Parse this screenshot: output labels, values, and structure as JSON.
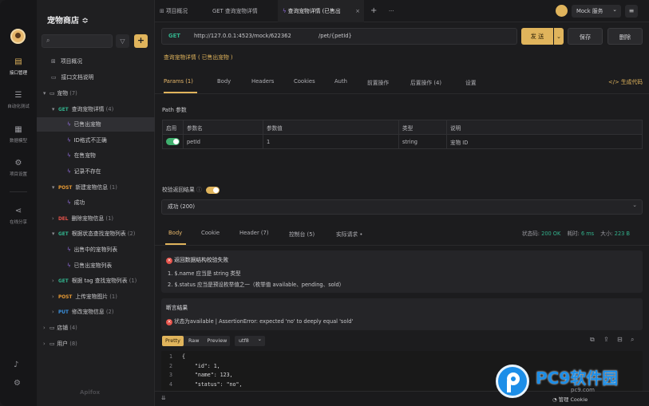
{
  "window": {
    "traffic_lights": [
      "#ff5f57",
      "#febc2e",
      "#28c840"
    ]
  },
  "rail": {
    "items": [
      {
        "label": "接口管理",
        "icon": "api-icon"
      },
      {
        "label": "自动化测试",
        "icon": "test-icon"
      },
      {
        "label": "数据模型",
        "icon": "model-icon"
      },
      {
        "label": "项目设置",
        "icon": "settings-icon"
      },
      {
        "label": "在线分享",
        "icon": "share-icon"
      }
    ]
  },
  "sidebar": {
    "project_name": "宠物商店 ≎",
    "search_placeholder": "",
    "add_label": "+",
    "top_items": [
      {
        "label": "项目概况"
      },
      {
        "label": "接口文档说明"
      }
    ],
    "tree": [
      {
        "indent": 0,
        "arrow": "▾",
        "folder": true,
        "label": "宠物",
        "count": "(7)"
      },
      {
        "indent": 1,
        "arrow": "▾",
        "method": "GET",
        "mclass": "m-get",
        "label": "查询宠物详情",
        "count": "(4)"
      },
      {
        "indent": 2,
        "case": true,
        "label": "已售出宠物",
        "selected": true
      },
      {
        "indent": 2,
        "case": true,
        "label": "ID格式不正确"
      },
      {
        "indent": 2,
        "case": true,
        "label": "在售宠物"
      },
      {
        "indent": 2,
        "case": true,
        "label": "记录不存在"
      },
      {
        "indent": 1,
        "arrow": "▾",
        "method": "POST",
        "mclass": "m-post",
        "label": "新建宠物信息",
        "count": "(1)"
      },
      {
        "indent": 2,
        "case": true,
        "label": "成功"
      },
      {
        "indent": 1,
        "arrow": "›",
        "method": "DEL",
        "mclass": "m-del",
        "label": "删除宠物信息",
        "count": "(1)"
      },
      {
        "indent": 1,
        "arrow": "▾",
        "method": "GET",
        "mclass": "m-get",
        "label": "根据状态查找宠物列表",
        "count": "(2)"
      },
      {
        "indent": 2,
        "case": true,
        "label": "出售中的宠物列表"
      },
      {
        "indent": 2,
        "case": true,
        "label": "已售出宠物列表"
      },
      {
        "indent": 1,
        "arrow": "›",
        "method": "GET",
        "mclass": "m-get",
        "label": "根据 tag 查找宠物列表",
        "count": "(1)"
      },
      {
        "indent": 1,
        "arrow": "›",
        "method": "POST",
        "mclass": "m-post",
        "label": "上传宠物图片",
        "count": "(1)"
      },
      {
        "indent": 1,
        "arrow": "›",
        "method": "PUT",
        "mclass": "m-put",
        "label": "修改宠物信息",
        "count": "(2)"
      },
      {
        "indent": 0,
        "arrow": "›",
        "folder": true,
        "label": "店铺",
        "count": "(4)"
      },
      {
        "indent": 0,
        "arrow": "›",
        "folder": true,
        "label": "用户",
        "count": "(8)"
      }
    ],
    "footer_logo": "Apifox"
  },
  "tabs": [
    {
      "label": "项目概况",
      "icon": "grid-icon"
    },
    {
      "label": "GET 查询宠物详情",
      "method": "GET"
    },
    {
      "label": "查询宠物详情 (已售出",
      "active": true,
      "icon": "bolt-icon"
    }
  ],
  "tabbar": {
    "add": "+",
    "more": "···",
    "env_label": "Mock 服务",
    "env_chevron": "⌄",
    "menu": "≡"
  },
  "request": {
    "method": "GET",
    "base_url": "http://127.0.0.1:4523/mock/622362",
    "path": "/pet/{petId}",
    "send_label": "发 送",
    "save_label": "保存",
    "delete_label": "删除",
    "description": "查询宠物详情 ( 已售出宠物 )"
  },
  "req_tabs": [
    {
      "label": "Params (1)",
      "active": true
    },
    {
      "label": "Body"
    },
    {
      "label": "Headers"
    },
    {
      "label": "Cookies"
    },
    {
      "label": "Auth"
    },
    {
      "label": "前置操作"
    },
    {
      "label": "后置操作 (4)"
    },
    {
      "label": "设置"
    }
  ],
  "gen_code_label": "生成代码",
  "path_params": {
    "title": "Path 参数",
    "headers": [
      "启用",
      "参数名",
      "参数值",
      "类型",
      "说明"
    ],
    "rows": [
      {
        "enabled": true,
        "name": "petId",
        "value": "1",
        "type": "string",
        "desc": "宠物 ID"
      }
    ]
  },
  "validate": {
    "label": "校验返回结果",
    "info": "ⓘ",
    "selected": "成功 (200)"
  },
  "resp_tabs": [
    {
      "label": "Body",
      "active": true
    },
    {
      "label": "Cookie"
    },
    {
      "label": "Header (7)"
    },
    {
      "label": "控制台 (5)"
    },
    {
      "label": "实际请求 •"
    }
  ],
  "resp_status": {
    "status_label": "状态码:",
    "status_value": "200 OK",
    "time_label": "耗时:",
    "time_value": "6 ms",
    "size_label": "大小:",
    "size_value": "223 B"
  },
  "validation_error": {
    "title": "返回数据结构校验失败",
    "items": [
      "1. $.name 应当是 string 类型",
      "2. $.status 应当是预设枚举值之一（枚举值 available、pending、sold）"
    ]
  },
  "assertion": {
    "title": "断言结果",
    "message": "状态为available | AssertionError: expected 'no' to deeply equal 'sold'"
  },
  "format_tabs": [
    {
      "label": "Pretty",
      "active": true
    },
    {
      "label": "Raw"
    },
    {
      "label": "Preview"
    }
  ],
  "encoding": "utf8",
  "code_lines": [
    {
      "n": "1",
      "text": "{"
    },
    {
      "n": "2",
      "text": "    \"id\": 1,"
    },
    {
      "n": "3",
      "text": "    \"name\": 123,"
    },
    {
      "n": "4",
      "text": "    \"status\": \"no\","
    }
  ],
  "footer": {
    "cookie_label": "管理 Cookie"
  },
  "watermark": {
    "brand": "PC9软件园",
    "url": "pc9.com"
  },
  "colors": {
    "accent": "#e0b45c",
    "get": "#32b28c",
    "post": "#e79a34",
    "delete": "#e5534b",
    "put": "#3a91e0",
    "error": "#e5534b"
  }
}
